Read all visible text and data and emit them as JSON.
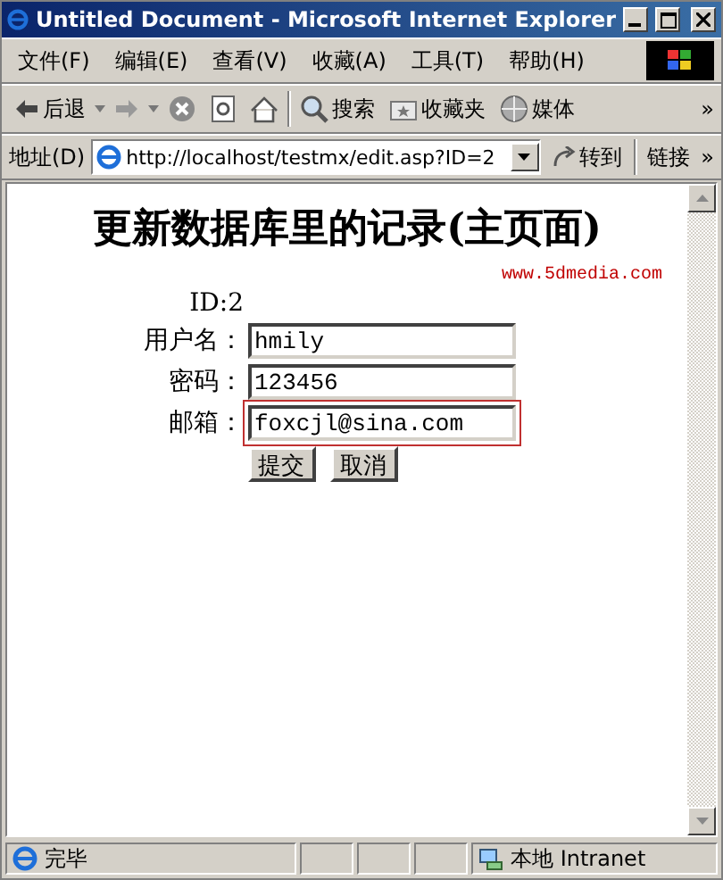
{
  "window": {
    "title": "Untitled Document - Microsoft Internet Explorer"
  },
  "menu": [
    "文件(F)",
    "编辑(E)",
    "查看(V)",
    "收藏(A)",
    "工具(T)",
    "帮助(H)"
  ],
  "toolbar": {
    "items": [
      {
        "kind": "back",
        "label": "后退"
      },
      {
        "kind": "forward"
      },
      {
        "kind": "stop"
      },
      {
        "kind": "refresh"
      },
      {
        "kind": "home"
      },
      {
        "kind": "search",
        "label": "搜索"
      },
      {
        "kind": "favorites",
        "label": "收藏夹"
      },
      {
        "kind": "media",
        "label": "媒体"
      }
    ],
    "more": "»"
  },
  "address": {
    "label": "地址(D)",
    "url": "http://localhost/testmx/edit.asp?ID=2",
    "go": "转到",
    "links": "链接",
    "more": "»"
  },
  "page": {
    "heading": "更新数据库里的记录(主页面)",
    "link": "www.5dmedia.com",
    "id_text": "ID:2",
    "fields": [
      {
        "label": "用户名：",
        "value": "hmily",
        "focused": false
      },
      {
        "label": "密码：",
        "value": "123456",
        "focused": false
      },
      {
        "label": "邮箱：",
        "value": "foxcjl@sina.com",
        "focused": true
      }
    ],
    "buttons": [
      "提交",
      "取消"
    ]
  },
  "status_bar": {
    "text": "完毕",
    "zone": "本地 Intranet"
  }
}
